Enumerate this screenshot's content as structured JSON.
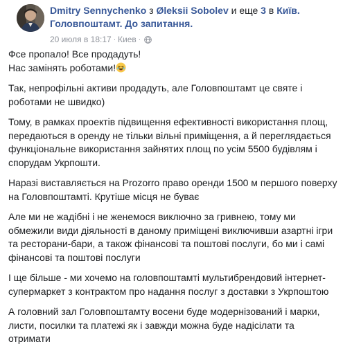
{
  "post": {
    "author": "Dmitry Sennychenko",
    "with_prefix": "з",
    "tagged_person": "Øleksii Sobolev",
    "and_more": "и еще",
    "others_link": "3",
    "in_word": "в",
    "location_1": "Київ.",
    "location_2": "Головпоштамт. До запитання.",
    "timestamp": "20 июля в 18:17",
    "separator": "·",
    "place": "Киев",
    "privacy_icon": "globe-icon",
    "paragraphs": [
      "Фсе пропало! Все продадуть!\nНас замінять роботами!",
      "Так, непрофільні активи продадуть, але Головпоштамт це святе і роботами не швидко)",
      "Тому, в рамках проектів підвищення ефективності використання площ, передаються в оренду не тільки вільні приміщення, а й переглядається функціональне використання зайнятих площ по усім 5500 будівлям і спорудам Укрпошти.",
      "Наразі виставляється на Prozorro право оренди 1500 м першого поверху на Головпоштамті. Крутіше місця не буває",
      "Але ми не жадібні і не женемося виключно за гривнею, тому ми обмежили види діяльності в даному приміщені виключивши азартні ігри та ресторани-бари, а також фінансові та поштові послуги, бо ми і самі фінансові та поштові послуги",
      "І ще більше - ми хочемо на головпоштамті мультибрендовий інтернет-супермаркет з контрактом про надання послуг з доставки з Укрпоштою",
      "А головний зал Головпоштамту восени буде модернізований і марки, листи, посилки та платежі як і завжди можна буде надісілати та отримати"
    ],
    "emoji_icon": "laughing-emoji-icon",
    "colors": {
      "link": "#385898",
      "meta": "#90949c",
      "text": "#1c1e21"
    }
  }
}
